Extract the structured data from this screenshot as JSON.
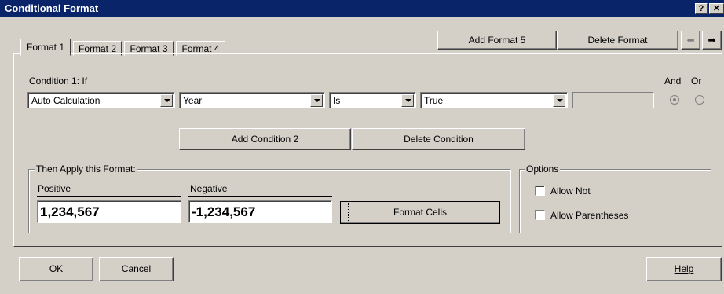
{
  "window": {
    "title": "Conditional Format",
    "help_glyph": "?",
    "close_glyph": "✕"
  },
  "tabs": [
    {
      "label": "Format 1",
      "selected": true
    },
    {
      "label": "Format 2",
      "selected": false
    },
    {
      "label": "Format 3",
      "selected": false
    },
    {
      "label": "Format 4",
      "selected": false
    }
  ],
  "toolbar": {
    "add_format_label": "Add Format 5",
    "delete_format_label": "Delete Format",
    "prev_glyph": "⬅",
    "next_glyph": "➡"
  },
  "condition": {
    "label": "Condition 1: If",
    "field1": "Auto Calculation",
    "field2": "Year",
    "operator": "Is",
    "value": "True",
    "extra_value": "",
    "and_label": "And",
    "or_label": "Or",
    "and_selected": true
  },
  "condition_buttons": {
    "add_label": "Add Condition 2",
    "delete_label": "Delete Condition"
  },
  "apply_format": {
    "legend": "Then Apply this Format:",
    "positive_label": "Positive",
    "positive_value": "1,234,567",
    "negative_label": "Negative",
    "negative_value": "-1,234,567",
    "format_cells_label": "Format Cells"
  },
  "options": {
    "legend": "Options",
    "allow_not_label": "Allow Not",
    "allow_not_checked": false,
    "allow_parentheses_label": "Allow Parentheses",
    "allow_parentheses_checked": false
  },
  "footer": {
    "ok_label": "OK",
    "cancel_label": "Cancel",
    "help_label": "Help"
  }
}
